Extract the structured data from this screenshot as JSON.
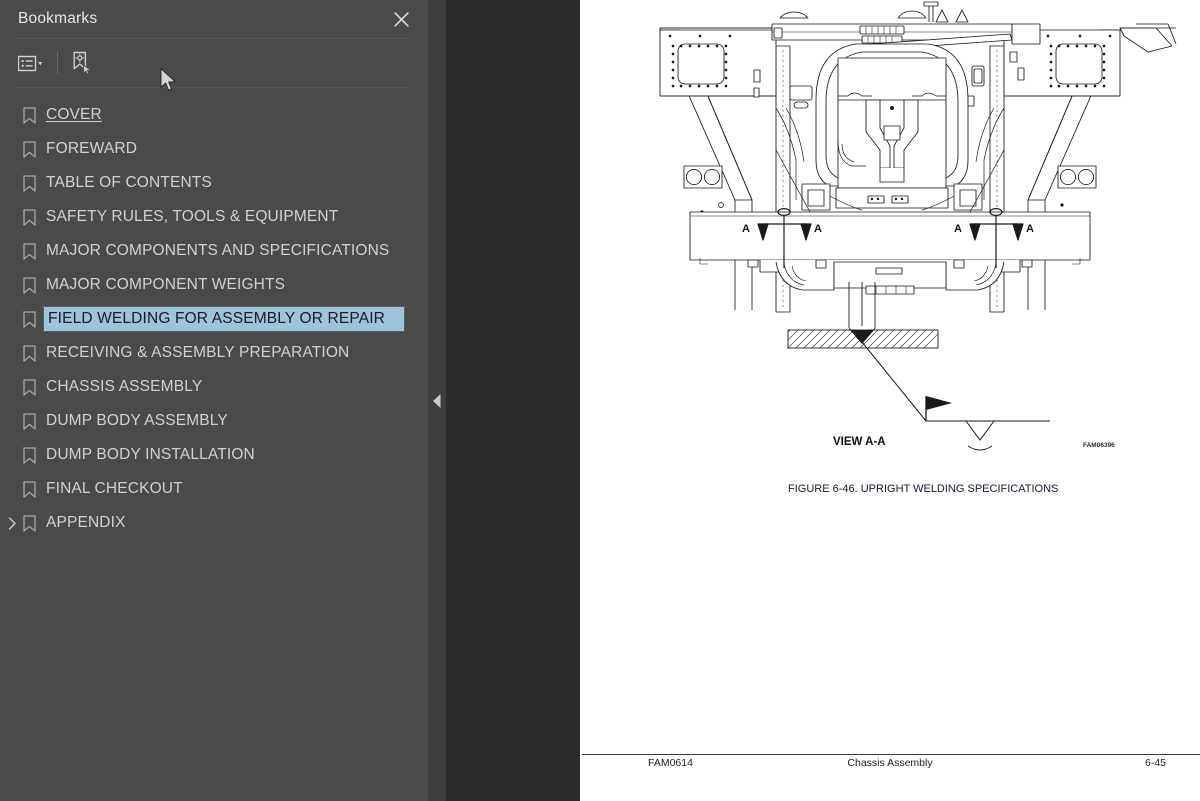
{
  "panel": {
    "title": "Bookmarks",
    "close_icon": "close-icon",
    "toolbar": {
      "options_label": "Options",
      "options_icon": "list-options-icon",
      "dropdown_icon": "chevron-down-icon",
      "new_bookmark_label": "New Bookmark",
      "new_bookmark_icon": "new-bookmark-icon"
    },
    "collapse_handle_icon": "triangle-left-icon"
  },
  "bookmarks": [
    {
      "label": "COVER",
      "state": "visited",
      "expandable": false
    },
    {
      "label": "FOREWARD",
      "state": "normal",
      "expandable": false
    },
    {
      "label": "TABLE OF CONTENTS",
      "state": "normal",
      "expandable": false
    },
    {
      "label": "SAFETY RULES, TOOLS & EQUIPMENT",
      "state": "normal",
      "expandable": false
    },
    {
      "label": "MAJOR COMPONENTS AND SPECIFICATIONS",
      "state": "normal",
      "expandable": false
    },
    {
      "label": "MAJOR COMPONENT WEIGHTS",
      "state": "normal",
      "expandable": false
    },
    {
      "label": "FIELD WELDING FOR ASSEMBLY OR REPAIR",
      "state": "selected",
      "expandable": false
    },
    {
      "label": "RECEIVING & ASSEMBLY PREPARATION",
      "state": "normal",
      "expandable": false
    },
    {
      "label": "CHASSIS ASSEMBLY",
      "state": "normal",
      "expandable": false
    },
    {
      "label": "DUMP BODY ASSEMBLY",
      "state": "normal",
      "expandable": false
    },
    {
      "label": "DUMP BODY INSTALLATION",
      "state": "normal",
      "expandable": false
    },
    {
      "label": "FINAL CHECKOUT",
      "state": "normal",
      "expandable": false
    },
    {
      "label": "APPENDIX",
      "state": "normal",
      "expandable": true
    }
  ],
  "document": {
    "view_label": "VIEW A-A",
    "drawing_code": "FAM06396",
    "figure_caption": "FIGURE 6-46. UPRIGHT WELDING SPECIFICATIONS",
    "section_marks": [
      "A",
      "A",
      "A",
      "A"
    ],
    "footer": {
      "left": "FAM0614",
      "center": "Chassis Assembly",
      "right": "6-45"
    }
  },
  "colors": {
    "sidebar_bg": "#4a4a4a",
    "splitter_bg": "#3e3e3e",
    "viewer_bg": "#2b2b2b",
    "page_bg": "#ffffff",
    "selection": "#9dc3dd",
    "label_text": "#d2d2d2"
  }
}
